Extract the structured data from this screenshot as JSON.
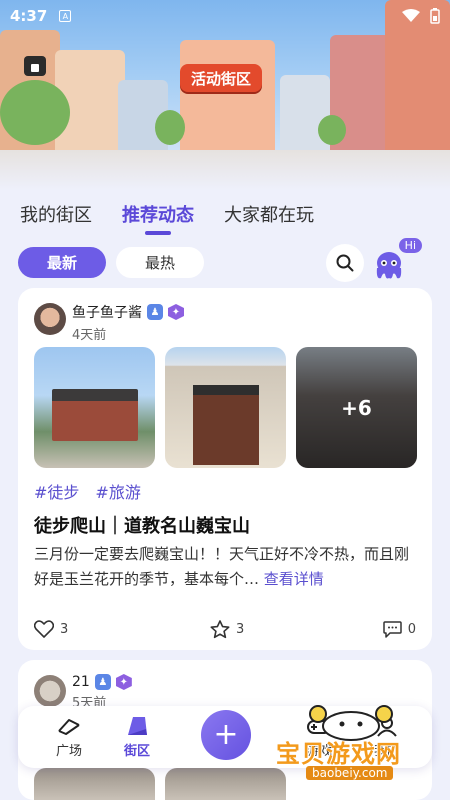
{
  "status_bar": {
    "time": "4:37",
    "sim_label": "A"
  },
  "hero": {
    "sign_text": "活动街区"
  },
  "main_tabs": [
    {
      "label": "我的街区",
      "active": false
    },
    {
      "label": "推荐动态",
      "active": true
    },
    {
      "label": "大家都在玩",
      "active": false
    }
  ],
  "filters": {
    "latest": "最新",
    "hottest": "最热"
  },
  "mascot": {
    "bubble": "Hi"
  },
  "posts": [
    {
      "author": "鱼子鱼子酱",
      "time_ago": "4天前",
      "extra_photos": "+6",
      "tags": [
        "#徒步",
        "#旅游"
      ],
      "title": "徒步爬山｜道教名山巍宝山",
      "body": "三月份一定要去爬巍宝山！！天气正好不冷不热，而且刚好是玉兰花开的季节，基本每个…",
      "more_label": "查看详情",
      "likes": "3",
      "favorites": "3",
      "comments": "0"
    },
    {
      "author": "21",
      "time_ago": "5天前"
    }
  ],
  "bottom_nav": {
    "plaza": "广场",
    "street": "街区",
    "play": "游戏",
    "me": "我的"
  },
  "watermark": {
    "text": "宝贝游戏网",
    "url": "baobeiy.com"
  },
  "colors": {
    "accent": "#6d5ce6",
    "tag": "#5a4fcf",
    "background": "#eef0fb"
  }
}
